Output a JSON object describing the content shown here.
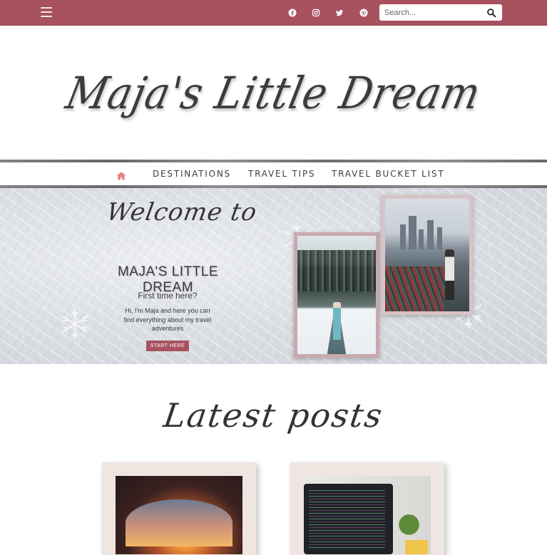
{
  "topbar": {
    "menu_icon": "hamburger-icon",
    "social_icons": [
      "facebook-icon",
      "instagram-icon",
      "twitter-icon",
      "pinterest-icon"
    ],
    "search": {
      "placeholder": "Search...",
      "value": "",
      "button_icon": "search-icon"
    },
    "background_color": "#a8525f"
  },
  "logo": {
    "text": "Maja's Little Dream"
  },
  "nav": {
    "home_icon": "home-icon",
    "items": [
      {
        "label": "DESTINATIONS"
      },
      {
        "label": "TRAVEL TIPS"
      },
      {
        "label": "TRAVEL BUCKET LIST"
      }
    ],
    "home_color": "#e77f86"
  },
  "hero": {
    "welcome": "Welcome to",
    "title": "MAJA'S LITTLE DREAM",
    "subtitle": "First time here?",
    "description": "Hi, I'm Maja and here you can find everything about my travel adventures",
    "button_label": "START HERE",
    "photos": [
      "snowy-road-photo",
      "city-bridge-photo"
    ]
  },
  "latest": {
    "title": "Latest posts",
    "posts": [
      {
        "image": "rock-arch-sunset-photo"
      },
      {
        "image": "laptop-code-photo"
      }
    ]
  }
}
